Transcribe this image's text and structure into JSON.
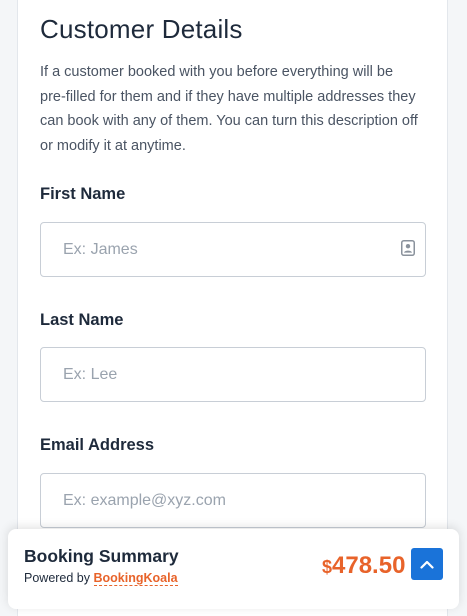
{
  "customer_details": {
    "title": "Customer Details",
    "description": "If a customer booked with you before everything will be pre-filled for them and if they have multiple addresses they can book with any of them. You can turn this description off or modify it at anytime.",
    "fields": {
      "first_name": {
        "label": "First Name",
        "placeholder": "Ex: James",
        "value": ""
      },
      "last_name": {
        "label": "Last Name",
        "placeholder": "Ex: Lee",
        "value": ""
      },
      "email": {
        "label": "Email Address",
        "placeholder": "Ex: example@xyz.com",
        "value": ""
      }
    },
    "first_name_icon": "contact-card-icon"
  },
  "summary": {
    "title": "Booking Summary",
    "powered_by": "Powered by",
    "brand": "BookingKoala",
    "currency": "$",
    "amount": "478.50",
    "scroll_icon": "chevron-up-icon"
  },
  "colors": {
    "accent": "#e8632a",
    "primary_button": "#1a73d9",
    "text": "#1e2a3b"
  }
}
